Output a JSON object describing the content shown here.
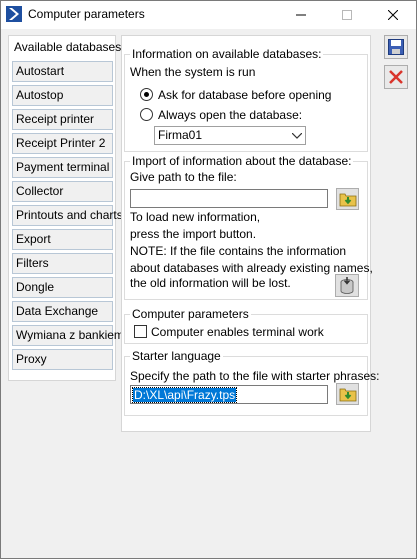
{
  "window": {
    "title": "Computer parameters"
  },
  "sidebar": {
    "items": [
      {
        "label": "Available databases"
      },
      {
        "label": "Autostart"
      },
      {
        "label": "Autostop"
      },
      {
        "label": "Receipt printer"
      },
      {
        "label": "Receipt Printer 2"
      },
      {
        "label": "Payment terminal"
      },
      {
        "label": "Collector"
      },
      {
        "label": "Printouts and charts"
      },
      {
        "label": "Export"
      },
      {
        "label": "Filters"
      },
      {
        "label": "Dongle"
      },
      {
        "label": "Data Exchange"
      },
      {
        "label": "Wymiana z bankiem"
      },
      {
        "label": "Proxy"
      }
    ]
  },
  "databases": {
    "legend": "Information on available databases:",
    "when_label": "When the system is run",
    "option_ask": "Ask for database before opening",
    "option_always": "Always open the database:",
    "database_value": "Firma01"
  },
  "import": {
    "legend": "Import of information about the database:",
    "path_label": "Give path to the file:",
    "path_value": "",
    "note1": "To load new information,",
    "note2": "press the import button.",
    "note3": "NOTE: If the file contains the information",
    "note4": "about databases with already existing names,",
    "note5": "the old information will be lost."
  },
  "computer": {
    "legend": "Computer parameters",
    "terminal_label": "Computer enables terminal work"
  },
  "starter": {
    "legend": "Starter language",
    "path_label": "Specify the path to the file with starter phrases:",
    "path_value": "D:\\XL\\api\\Frazy.tps"
  },
  "colors": {
    "accent": "#0078d7",
    "brand": "#1e4fa0",
    "close": "#d9342b"
  }
}
